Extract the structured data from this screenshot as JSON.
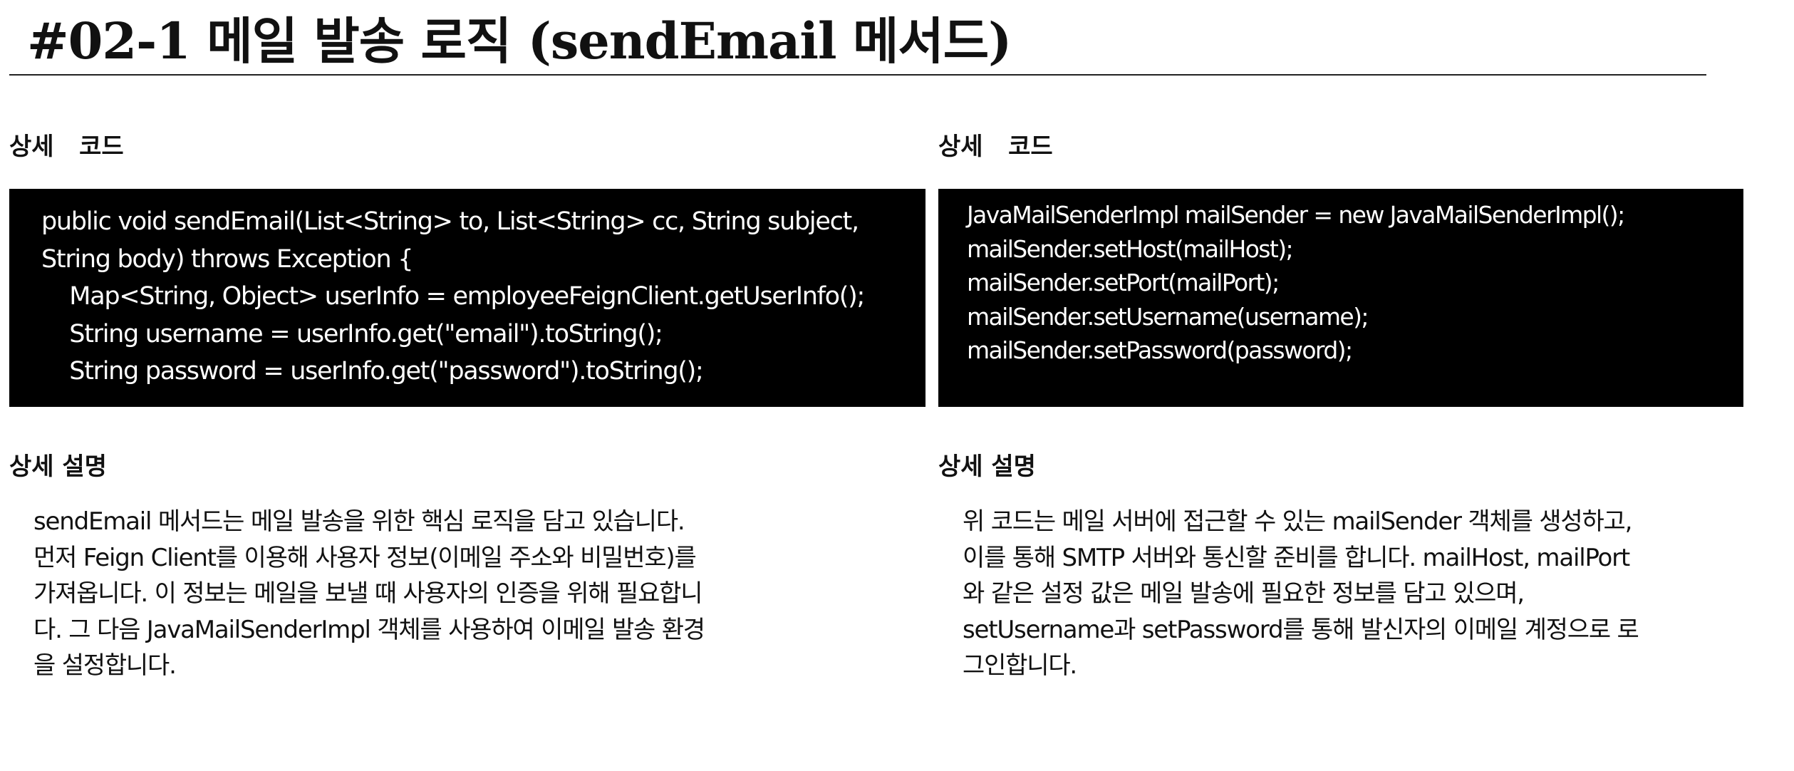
{
  "title": "#02-1 메일 발송 로직 (sendEmail 메서드)",
  "left_panel": {
    "code_heading": "상세   코드",
    "code_lines": [
      "public void sendEmail(List<String> to, List<String> cc, String subject,",
      "String body) throws Exception {",
      "    Map<String, Object> userInfo = employeeFeignClient.getUserInfo();",
      "    String username = userInfo.get(\"email\").toString();",
      "    String password = userInfo.get(\"password\").toString();"
    ],
    "desc_heading": "상세 설명",
    "desc_lines": [
      "sendEmail 메서드는 메일 발송을 위한 핵심 로직을 담고 있습니다.",
      "먼저 Feign Client를 이용해 사용자 정보(이메일 주소와 비밀번호)를",
      "가져옵니다. 이 정보는 메일을 보낼 때 사용자의 인증을 위해 필요합니",
      "다. 그 다음 JavaMailSenderImpl 객체를 사용하여 이메일 발송 환경",
      "을 설정합니다."
    ]
  },
  "right_panel": {
    "code_heading": "상세   코드",
    "code_lines": [
      "JavaMailSenderImpl mailSender = new JavaMailSenderImpl();",
      "mailSender.setHost(mailHost);",
      "mailSender.setPort(mailPort);",
      "mailSender.setUsername(username);",
      "mailSender.setPassword(password);"
    ],
    "desc_heading": "상세 설명",
    "desc_lines": [
      "위 코드는 메일 서버에 접근할 수 있는 mailSender 객체를 생성하고,",
      "이를 통해 SMTP 서버와 통신할 준비를 합니다. mailHost, mailPort",
      "와 같은 설정 값은 메일 발송에 필요한 정보를 담고 있으며,",
      "setUsername과 setPassword를 통해 발신자의 이메일 계정으로 로",
      "그인합니다."
    ]
  }
}
